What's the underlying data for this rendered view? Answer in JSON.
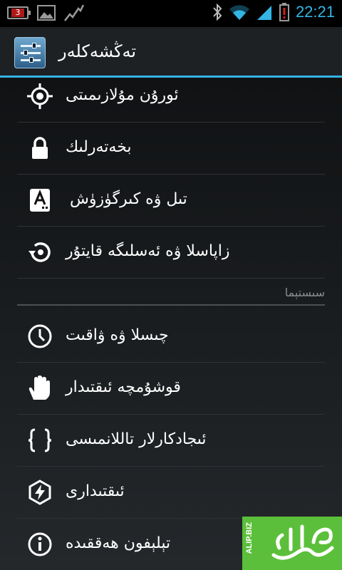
{
  "status_bar": {
    "battery_badge": "3",
    "time": "22:21"
  },
  "header": {
    "title": "تەڭشەكلەر",
    "app_icon": "settings-sliders-icon"
  },
  "items_top": [
    {
      "label": "ئورۇن مۇلازىمىتى",
      "icon": "location-target-icon"
    },
    {
      "label": "بخەتەرلىك",
      "icon": "lock-icon"
    },
    {
      "label": "تىل ۋە كىرگۈزۈش",
      "icon": "keyboard-a-icon"
    },
    {
      "label": "زاپاسلا ۋە ئەسلىگە قايتۇر",
      "icon": "restore-icon"
    }
  ],
  "section": {
    "title": "سىستېما"
  },
  "items_bottom": [
    {
      "label": "چىسلا ۋە ۋاقىت",
      "icon": "clock-icon"
    },
    {
      "label": "قوشۇمچە ئىقتىدار",
      "icon": "hand-icon"
    },
    {
      "label": "ئىجادكارلار تاللانمىسى",
      "icon": "braces-icon"
    },
    {
      "label": "ئىقتىدارى",
      "icon": "power-bolt-icon"
    },
    {
      "label": "تېلېفون ھەققىدە",
      "icon": "info-icon"
    }
  ],
  "watermark": {
    "text": "ALIP.BIZ",
    "brand": "alip-logo"
  },
  "colors": {
    "accent": "#33b5e5",
    "watermark_green": "#5cbf3b",
    "battery_red": "#b01818"
  }
}
